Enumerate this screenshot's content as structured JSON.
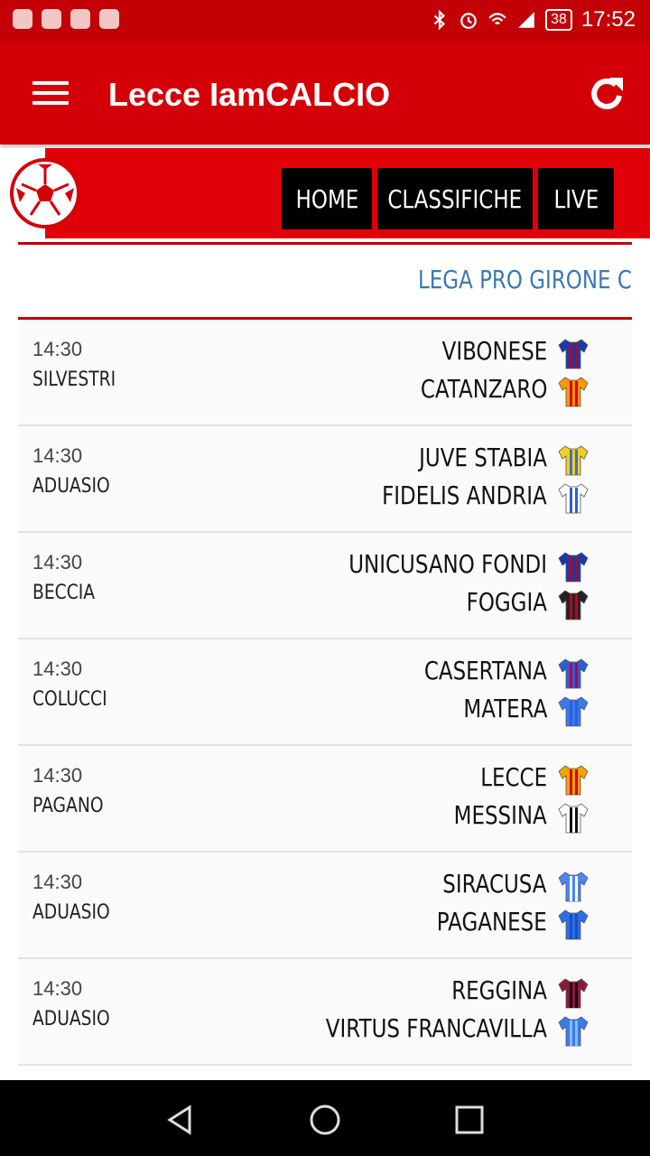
{
  "status_bar": {
    "time": "17:52",
    "battery": "38"
  },
  "app_bar": {
    "title": "Lecce IamCALCIO",
    "menu_icon": "hamburger-menu-icon",
    "refresh_icon": "refresh-icon"
  },
  "nav": {
    "home": "HOME",
    "classifiche": "CLASSIFICHE",
    "live": "LIVE"
  },
  "league": "LEGA PRO GIRONE C",
  "matches": [
    {
      "time": "14:30",
      "referee": "SILVESTRI",
      "home": "VIBONESE",
      "away": "CATANZARO"
    },
    {
      "time": "14:30",
      "referee": "ADUASIO",
      "home": "JUVE STABIA",
      "away": "FIDELIS ANDRIA"
    },
    {
      "time": "14:30",
      "referee": "BECCIA",
      "home": "UNICUSANO FONDI",
      "away": "FOGGIA"
    },
    {
      "time": "14:30",
      "referee": "COLUCCI",
      "home": "CASERTANA",
      "away": "MATERA"
    },
    {
      "time": "14:30",
      "referee": "PAGANO",
      "home": "LECCE",
      "away": "MESSINA"
    },
    {
      "time": "14:30",
      "referee": "ADUASIO",
      "home": "SIRACUSA",
      "away": "PAGANESE"
    },
    {
      "time": "14:30",
      "referee": "ADUASIO",
      "home": "REGGINA",
      "away": "VIRTUS FRANCAVILLA"
    }
  ],
  "colors": {
    "primary": "#d40008",
    "status": "#c20006",
    "league_text": "#3a79ae"
  }
}
